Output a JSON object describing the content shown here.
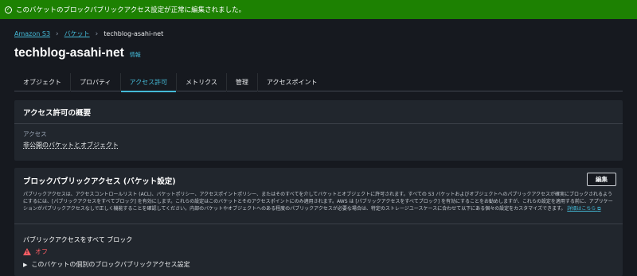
{
  "banner": {
    "message": "このバケットのブロックパブリックアクセス設定が正常に編集されました。",
    "color": "#1d8102"
  },
  "breadcrumb": {
    "items": [
      "Amazon S3",
      "バケット",
      "techblog-asahi-net"
    ]
  },
  "page": {
    "title": "techblog-asahi-net",
    "info_link": "情報"
  },
  "tabs": [
    {
      "label": "オブジェクト"
    },
    {
      "label": "プロパティ"
    },
    {
      "label": "アクセス許可",
      "active": true
    },
    {
      "label": "メトリクス"
    },
    {
      "label": "管理"
    },
    {
      "label": "アクセスポイント"
    }
  ],
  "overview": {
    "heading": "アクセス許可の概要",
    "access_label": "アクセス",
    "access_value": "非公開のバケットとオブジェクト"
  },
  "bpa": {
    "heading": "ブロックパブリックアクセス (バケット設定)",
    "edit_label": "編集",
    "description": "パブリックアクセスは、アクセスコントロールリスト (ACL)、バケットポリシー、アクセスポイントポリシー、またはそのすべてを介してバケットとオブジェクトに許可されます。すべての S3 バケットおよびオブジェクトへのパブリックアクセスが確実にブロックされるようにするには、[パブリックアクセスをすべてブロック] を有効にします。これらの設定はこのバケットとそのアクセスポイントにのみ適用されます。AWS は [パブリックアクセスをすべてブロック] を有効にすることをお勧めしますが、これらの設定を適用する前に、アプリケーションがパブリックアクセスなしで正しく機能することを確認してください。内部のバケットやオブジェクトへのある程度のパブリックアクセスが必要な場合は、特定のストレージユースケースに合わせて以下にある個々の設定をカスタマイズできます。",
    "more_link": "詳細はこちら",
    "setting_title": "パブリックアクセスをすべて ブロック",
    "status": "オフ",
    "expander": "このバケットの個別のブロックパブリックアクセス設定"
  },
  "colors": {
    "accent": "#44b9d6",
    "warning": "#ff5d64",
    "background": "#16191f"
  }
}
